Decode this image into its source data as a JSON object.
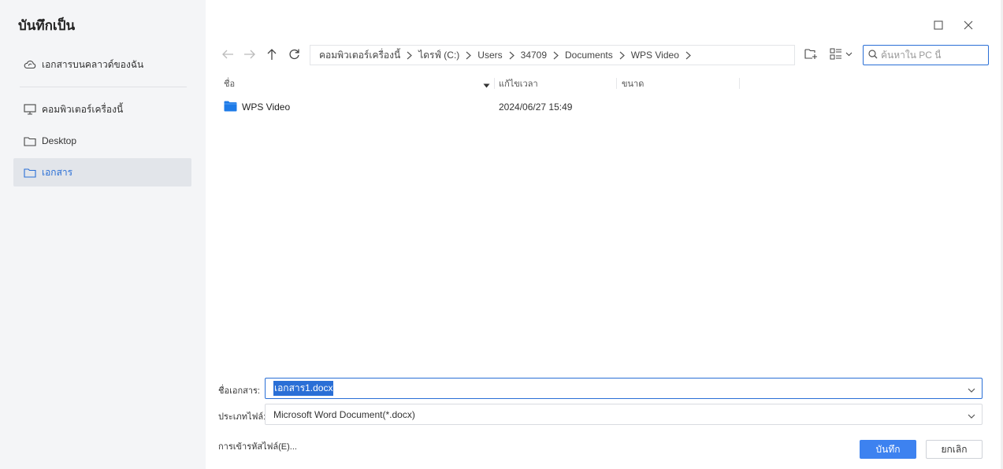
{
  "dialog": {
    "title": "บันทึกเป็น"
  },
  "sidebar": {
    "items": [
      {
        "label": "เอกสารบนคลาวด์ของฉัน",
        "icon": "cloud-icon"
      },
      {
        "label": "คอมพิวเตอร์เครื่องนี้",
        "icon": "computer-icon"
      },
      {
        "label": "Desktop",
        "icon": "folder-icon"
      },
      {
        "label": "เอกสาร",
        "icon": "folder-icon",
        "active": true
      }
    ]
  },
  "window_controls": {
    "maximize_icon": "maximize-icon",
    "close_icon": "close-icon"
  },
  "navigation": {
    "back_icon": "back-arrow-icon",
    "forward_icon": "forward-arrow-icon",
    "up_icon": "up-arrow-icon",
    "refresh_icon": "refresh-icon"
  },
  "breadcrumb": [
    "คอมพิวเตอร์เครื่องนี้",
    "ไดรฟ์ (C:)",
    "Users",
    "34709",
    "Documents",
    "WPS Video"
  ],
  "toolbar": {
    "new_folder_icon": "new-folder-icon",
    "view_icon": "view-mode-icon"
  },
  "search": {
    "placeholder": "ค้นหาใน PC นี้"
  },
  "file_list": {
    "columns": [
      "ชื่อ",
      "แก้ไขเวลา",
      "ขนาด"
    ],
    "rows": [
      {
        "name": "WPS Video",
        "modified": "2024/06/27 15:49",
        "size": "",
        "type": "folder"
      }
    ]
  },
  "form": {
    "filename_label": "ชื่อเอกสาร:",
    "filename_value": "เอกสาร1.docx",
    "filetype_label": "ประเภทไฟล์:",
    "filetype_value": "Microsoft Word Document(*.docx)",
    "encoding_link": "การเข้ารหัสไฟล์(E)..."
  },
  "buttons": {
    "save": "บันทึก",
    "cancel": "ยกเลิก"
  },
  "colors": {
    "accent": "#2a6fd6",
    "primary_button": "#3d82f0",
    "sidebar_bg": "#f4f5f7",
    "folder": "#1e7be8"
  }
}
